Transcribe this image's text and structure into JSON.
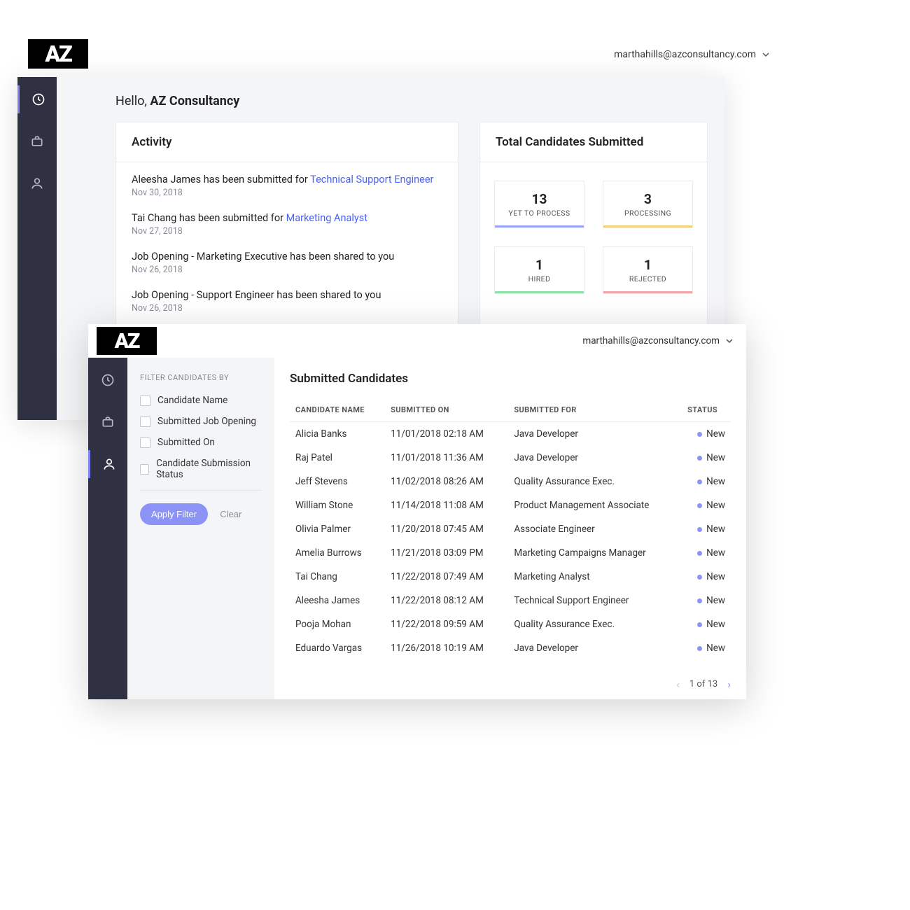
{
  "logo_text": "AZ",
  "user_email": "marthahills@azconsultancy.com",
  "back": {
    "hello_prefix": "Hello, ",
    "hello_name": "AZ Consultancy",
    "activity_title": "Activity",
    "activities": [
      {
        "prefix": "Aleesha James has been submitted for ",
        "link": "Technical Support Engineer",
        "date": "Nov 30, 2018"
      },
      {
        "prefix": "Tai Chang has been submitted for ",
        "link": "Marketing Analyst",
        "date": "Nov 27, 2018"
      },
      {
        "prefix": "Job Opening - Marketing Executive has been shared to you",
        "link": "",
        "date": "Nov 26, 2018"
      },
      {
        "prefix": "Job Opening - Support Engineer has been shared to you",
        "link": "",
        "date": "Nov 26, 2018"
      }
    ],
    "totals_title": "Total Candidates Submitted",
    "stats": [
      {
        "num": "13",
        "label": "YET TO PROCESS",
        "color": "blue"
      },
      {
        "num": "3",
        "label": "PROCESSING",
        "color": "yellow"
      },
      {
        "num": "1",
        "label": "HIRED",
        "color": "green"
      },
      {
        "num": "1",
        "label": "REJECTED",
        "color": "red"
      }
    ]
  },
  "front": {
    "filter_title": "FILTER CANDIDATES BY",
    "filter_options": [
      "Candidate Name",
      "Submitted Job Opening",
      "Submitted On",
      "Candidate Submission Status"
    ],
    "apply_label": "Apply Filter",
    "clear_label": "Clear",
    "table_title": "Submitted Candidates",
    "columns": {
      "name": "CANDIDATE NAME",
      "submitted_on": "SUBMITTED ON",
      "submitted_for": "SUBMITTED FOR",
      "status": "STATUS"
    },
    "rows": [
      {
        "name": "Alicia Banks",
        "on": "11/01/2018 02:18 AM",
        "for": "Java Developer",
        "status": "New"
      },
      {
        "name": "Raj Patel",
        "on": "11/01/2018 11:36 AM",
        "for": "Java Developer",
        "status": "New"
      },
      {
        "name": "Jeff Stevens",
        "on": "11/02/2018 08:26 AM",
        "for": "Quality Assurance Exec.",
        "status": "New"
      },
      {
        "name": "William Stone",
        "on": "11/14/2018 11:08 AM",
        "for": "Product Management Associate",
        "status": "New"
      },
      {
        "name": "Olivia Palmer",
        "on": "11/20/2018 07:45 AM",
        "for": "Associate Engineer",
        "status": "New"
      },
      {
        "name": "Amelia Burrows",
        "on": "11/21/2018 03:09 PM",
        "for": "Marketing Campaigns Manager",
        "status": "New"
      },
      {
        "name": "Tai Chang",
        "on": "11/22/2018 07:49 AM",
        "for": "Marketing Analyst",
        "status": "New"
      },
      {
        "name": "Aleesha James",
        "on": "11/22/2018 08:12 AM",
        "for": "Technical Support Engineer",
        "status": "New"
      },
      {
        "name": "Pooja Mohan",
        "on": "11/22/2018 09:59 AM",
        "for": "Quality Assurance Exec.",
        "status": "New"
      },
      {
        "name": "Eduardo Vargas",
        "on": "11/26/2018 10:19 AM",
        "for": "Java Developer",
        "status": "New"
      }
    ],
    "pager_text": "1 of 13"
  }
}
